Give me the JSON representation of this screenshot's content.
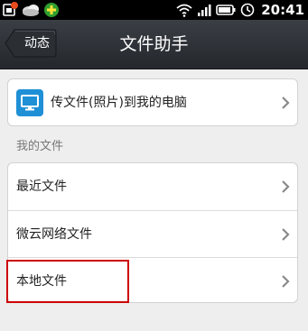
{
  "status_bar": {
    "time": "20:41",
    "icons": [
      "notification-app-icon",
      "weather-cloud-icon",
      "download-plus-icon",
      "wifi-icon",
      "signal-icon",
      "battery-icon",
      "alarm-clock-icon"
    ]
  },
  "header": {
    "back_label": "动态",
    "title": "文件助手"
  },
  "transfer_row": {
    "label": "传文件(照片)到我的电脑",
    "icon": "monitor-icon",
    "icon_color": "#1f8fd6"
  },
  "my_files": {
    "section_label": "我的文件",
    "items": [
      {
        "label": "最近文件"
      },
      {
        "label": "微云网络文件"
      },
      {
        "label": "本地文件"
      }
    ]
  },
  "highlight_color": "#cc0000"
}
